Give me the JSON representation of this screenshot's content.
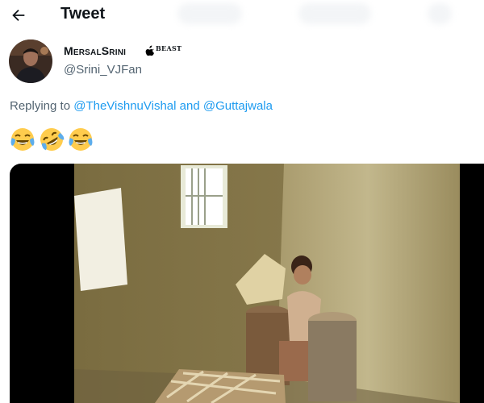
{
  "header": {
    "title": "Tweet",
    "back_icon": "arrow-left-icon"
  },
  "author": {
    "display_name": "MersalSrini",
    "badge_icon": "apple-icon",
    "badge_text": "BEAST",
    "handle": "@Srini_VJFan"
  },
  "reply": {
    "prefix": "Replying to",
    "user1": "@TheVishnuVishal",
    "conjunction": "and",
    "user2": "@Guttajwala"
  },
  "tweet": {
    "emojis": [
      "face-with-tears-of-joy",
      "rolling-on-the-floor-laughing",
      "face-with-tears-of-joy"
    ]
  },
  "colors": {
    "accent": "#1d9bf0",
    "secondary_text": "#536471",
    "text": "#0f1419"
  }
}
